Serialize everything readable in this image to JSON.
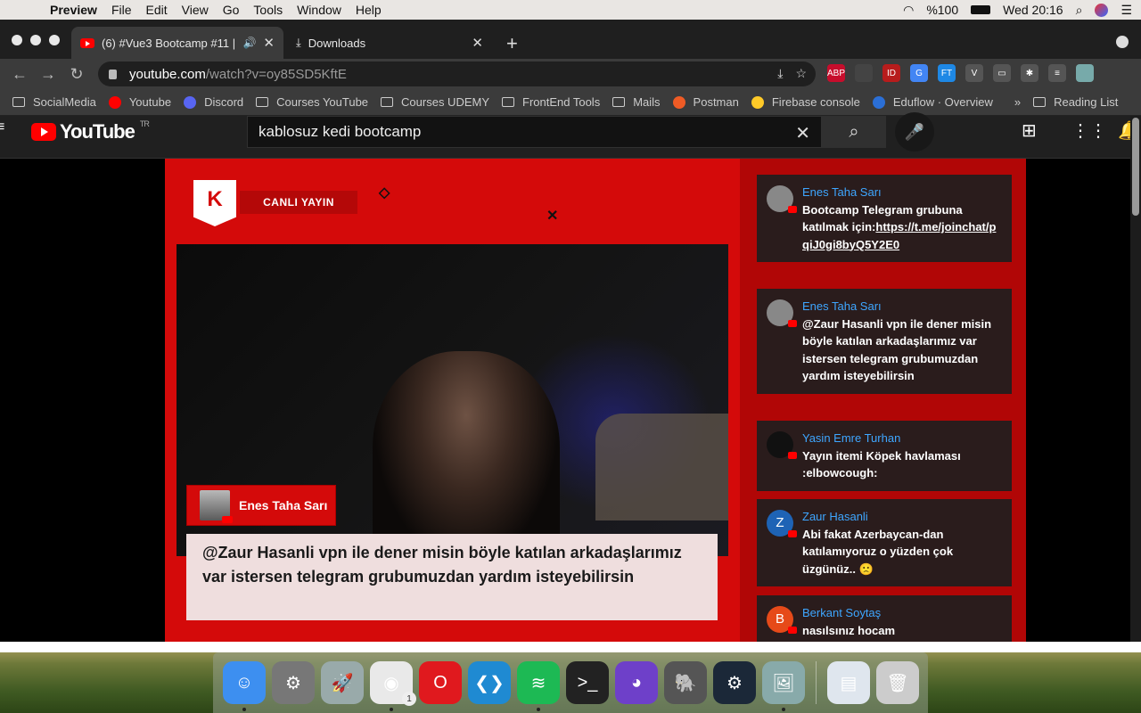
{
  "menubar": {
    "app": "Preview",
    "items": [
      "File",
      "Edit",
      "View",
      "Go",
      "Tools",
      "Window",
      "Help"
    ],
    "battery": "%100",
    "clock": "Wed 20:16"
  },
  "tabs": [
    {
      "title": "(6) #Vue3 Bootcamp #11 |"
    },
    {
      "title": "Downloads"
    }
  ],
  "address": {
    "domain": "youtube.com",
    "path": "/watch?v=oy85SD5KftE"
  },
  "extensions": [
    {
      "name": "adblock-icon",
      "label": "ABP",
      "badge": "8",
      "color": "#c70d2c"
    },
    {
      "name": "extension-2-icon",
      "label": "",
      "badge": "",
      "color": "#444"
    },
    {
      "name": "extension-3-icon",
      "label": "ID",
      "badge": "238",
      "color": "#b71c1c"
    },
    {
      "name": "translate-icon",
      "label": "G",
      "badge": "",
      "color": "#4285f4"
    },
    {
      "name": "ft-icon",
      "label": "FT",
      "badge": "",
      "color": "#1e88e5"
    },
    {
      "name": "vue-devtools-icon",
      "label": "V",
      "badge": "",
      "color": "#555"
    },
    {
      "name": "window-icon",
      "label": "▭",
      "badge": "",
      "color": "#555"
    },
    {
      "name": "extensions-puzzle-icon",
      "label": "✱",
      "badge": "",
      "color": "#555"
    },
    {
      "name": "reading-mode-icon",
      "label": "≡",
      "badge": "",
      "color": "#555"
    },
    {
      "name": "profile-icon",
      "label": "",
      "badge": "",
      "color": "#7aa"
    }
  ],
  "bookmarks": [
    {
      "label": "SocialMedia",
      "type": "folder"
    },
    {
      "label": "Youtube",
      "type": "yt"
    },
    {
      "label": "Discord",
      "type": "discord"
    },
    {
      "label": "Courses YouTube",
      "type": "folder"
    },
    {
      "label": "Courses UDEMY",
      "type": "folder"
    },
    {
      "label": "FrontEnd Tools",
      "type": "folder"
    },
    {
      "label": "Mails",
      "type": "folder"
    },
    {
      "label": "Postman",
      "type": "postman"
    },
    {
      "label": "Firebase console",
      "type": "firebase"
    },
    {
      "label": "Eduflow · Overview",
      "type": "eduflow"
    }
  ],
  "bookmarks_overflow": "»",
  "reading_list": "Reading List",
  "youtube": {
    "logo": "YouTube",
    "region": "TR",
    "search_value": "kablosuz kedi bootcamp"
  },
  "stream": {
    "logo_text": "K",
    "live_label": "CANLI YAYIN",
    "featured": {
      "author": "Enes Taha Sarı",
      "message": "@Zaur Hasanli vpn ile dener misin böyle katılan arkadaşlarımız var istersen telegram grubumuzdan yardım isteyebilirsin"
    }
  },
  "chat": [
    {
      "author": "Enes Taha Sarı",
      "text": "Bootcamp Telegram grubuna katılmak için:",
      "link": "https://t.me/joinchat/pqiJ0gi8byQ5Y2E0",
      "avatar": "",
      "avatar_color": "#888"
    },
    {
      "author": "Enes Taha Sarı",
      "text": "@Zaur Hasanli vpn ile dener misin böyle katılan arkadaşlarımız var istersen telegram grubumuzdan yardım isteyebilirsin",
      "link": "",
      "avatar": "",
      "avatar_color": "#888"
    },
    {
      "author": "Yasin Emre Turhan",
      "text": "Yayın itemi Köpek havlaması :elbowcough:",
      "link": "",
      "avatar": "",
      "avatar_color": "#111"
    },
    {
      "author": "Zaur Hasanli",
      "text": "Abi fakat Azerbaycan-dan katılamıyoruz o yüzden çok üzgünüz.. 🙁",
      "link": "",
      "avatar": "Z",
      "avatar_color": "#1e63b5"
    },
    {
      "author": "Berkant Soytaş",
      "text": "nasılsınız hocam",
      "link": "",
      "avatar": "B",
      "avatar_color": "#e64a19"
    }
  ],
  "dock": [
    {
      "name": "finder-icon",
      "glyph": "☺",
      "color": "#3d8ff0",
      "running": true
    },
    {
      "name": "system-preferences-icon",
      "glyph": "⚙",
      "color": "#777",
      "running": false
    },
    {
      "name": "launchpad-icon",
      "glyph": "🚀",
      "color": "#9aa",
      "running": false
    },
    {
      "name": "chrome-icon",
      "glyph": "◉",
      "color": "#e9e9e9",
      "running": true
    },
    {
      "name": "opera-icon",
      "glyph": "O",
      "color": "#e0191e",
      "running": false
    },
    {
      "name": "vscode-icon",
      "glyph": "❮❯",
      "color": "#1f8ad2",
      "running": false
    },
    {
      "name": "spotify-icon",
      "glyph": "≋",
      "color": "#1db954",
      "running": true
    },
    {
      "name": "terminal-icon",
      "glyph": ">_",
      "color": "#222",
      "running": false
    },
    {
      "name": "github-desktop-icon",
      "glyph": "◕",
      "color": "#6e40c9",
      "running": false
    },
    {
      "name": "tableplus-icon",
      "glyph": "🐘",
      "color": "#555",
      "running": false
    },
    {
      "name": "steam-icon",
      "glyph": "⚙",
      "color": "#1b2838",
      "running": false
    },
    {
      "name": "preview-icon",
      "glyph": "🖼",
      "color": "#8aa",
      "running": true
    },
    {
      "name": "downloads-stack-icon",
      "glyph": "▤",
      "color": "#dfe6ee",
      "running": false
    },
    {
      "name": "trash-icon",
      "glyph": "🗑",
      "color": "#ccc",
      "running": false
    }
  ],
  "chrome_badge": "1"
}
